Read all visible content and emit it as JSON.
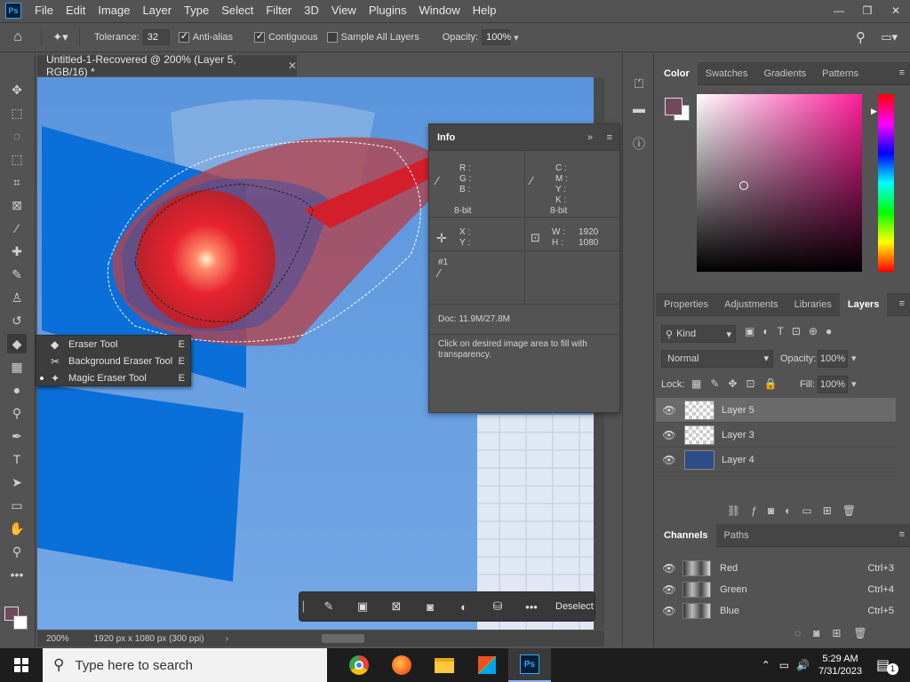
{
  "menubar": {
    "logo": "Ps",
    "items": [
      "File",
      "Edit",
      "Image",
      "Layer",
      "Type",
      "Select",
      "Filter",
      "3D",
      "View",
      "Plugins",
      "Window",
      "Help"
    ]
  },
  "options": {
    "tolerance_label": "Tolerance:",
    "tolerance_value": "32",
    "antialias_label": "Anti-alias",
    "contiguous_label": "Contiguous",
    "sample_all_label": "Sample All Layers",
    "opacity_label": "Opacity:",
    "opacity_value": "100%"
  },
  "document": {
    "tab_title": "Untitled-1-Recovered @ 200% (Layer 5, RGB/16) *",
    "zoom": "200%",
    "doc_info": "1920 px x 1080 px (300 ppi)"
  },
  "flyout": {
    "items": [
      {
        "label": "Eraser Tool",
        "key": "E"
      },
      {
        "label": "Background Eraser Tool",
        "key": "E"
      },
      {
        "label": "Magic Eraser Tool",
        "key": "E"
      }
    ]
  },
  "info": {
    "title": "Info",
    "rgb_r": "R :",
    "rgb_g": "G :",
    "rgb_b": "B :",
    "cmyk_c": "C :",
    "cmyk_m": "M :",
    "cmyk_y": "Y :",
    "cmyk_k": "K :",
    "bit_left": "8-bit",
    "bit_right": "8-bit",
    "x_label": "X :",
    "y_label": "Y :",
    "w_label": "W :",
    "w_value": "1920",
    "h_label": "H :",
    "h_value": "1080",
    "sample": "#1",
    "doc": "Doc: 11.9M/27.8M",
    "hint": "Click on desired image area to fill with transparency."
  },
  "color_panel": {
    "tabs": [
      "Color",
      "Swatches",
      "Gradients",
      "Patterns"
    ],
    "foreground": "#6e4a5c",
    "background": "#ffffff"
  },
  "layers_panel": {
    "tabs": [
      "Properties",
      "Adjustments",
      "Libraries",
      "Layers"
    ],
    "kind_label": "Kind",
    "blend_mode": "Normal",
    "opacity_label": "Opacity:",
    "opacity_value": "100%",
    "lock_label": "Lock:",
    "fill_label": "Fill:",
    "fill_value": "100%",
    "layers": [
      {
        "name": "Layer 5"
      },
      {
        "name": "Layer 3"
      },
      {
        "name": "Layer 4"
      }
    ]
  },
  "channels_panel": {
    "tabs": [
      "Channels",
      "Paths"
    ],
    "channels": [
      {
        "name": "Red",
        "key": "Ctrl+3"
      },
      {
        "name": "Green",
        "key": "Ctrl+4"
      },
      {
        "name": "Blue",
        "key": "Ctrl+5"
      }
    ]
  },
  "context_bar": {
    "deselect_label": "Deselect"
  },
  "windows": {
    "search_placeholder": "Type here to search",
    "time": "5:29 AM",
    "date": "7/31/2023",
    "notification_count": "1"
  }
}
